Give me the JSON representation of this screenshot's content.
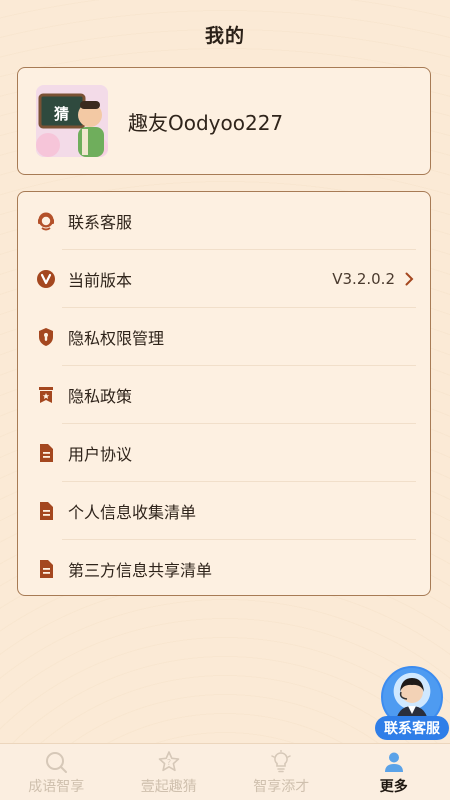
{
  "header": {
    "title": "我的"
  },
  "profile": {
    "username": "趣友Oodyoo227",
    "avatar_badge": "猜"
  },
  "menu": {
    "items": [
      {
        "label": "联系客服",
        "icon": "headset-icon"
      },
      {
        "label": "当前版本",
        "icon": "version-v-icon",
        "value": "V3.2.0.2"
      },
      {
        "label": "隐私权限管理",
        "icon": "shield-lock-icon"
      },
      {
        "label": "隐私政策",
        "icon": "bookmark-star-icon"
      },
      {
        "label": "用户协议",
        "icon": "document-icon"
      },
      {
        "label": "个人信息收集清单",
        "icon": "document-icon"
      },
      {
        "label": "第三方信息共享清单",
        "icon": "document-icon"
      }
    ]
  },
  "floating_service": {
    "label": "联系客服"
  },
  "tabbar": {
    "tabs": [
      {
        "label": "成语智享",
        "icon": "magnifier-icon",
        "active": false
      },
      {
        "label": "壹起趣猜",
        "icon": "star-question-icon",
        "active": false
      },
      {
        "label": "智享添才",
        "icon": "lightbulb-icon",
        "active": false
      },
      {
        "label": "更多",
        "icon": "person-icon",
        "active": true
      }
    ]
  },
  "colors": {
    "accent": "#a4471f",
    "background": "#fbead6",
    "border": "#a77b55",
    "service_blue": "#2f7ee8"
  }
}
